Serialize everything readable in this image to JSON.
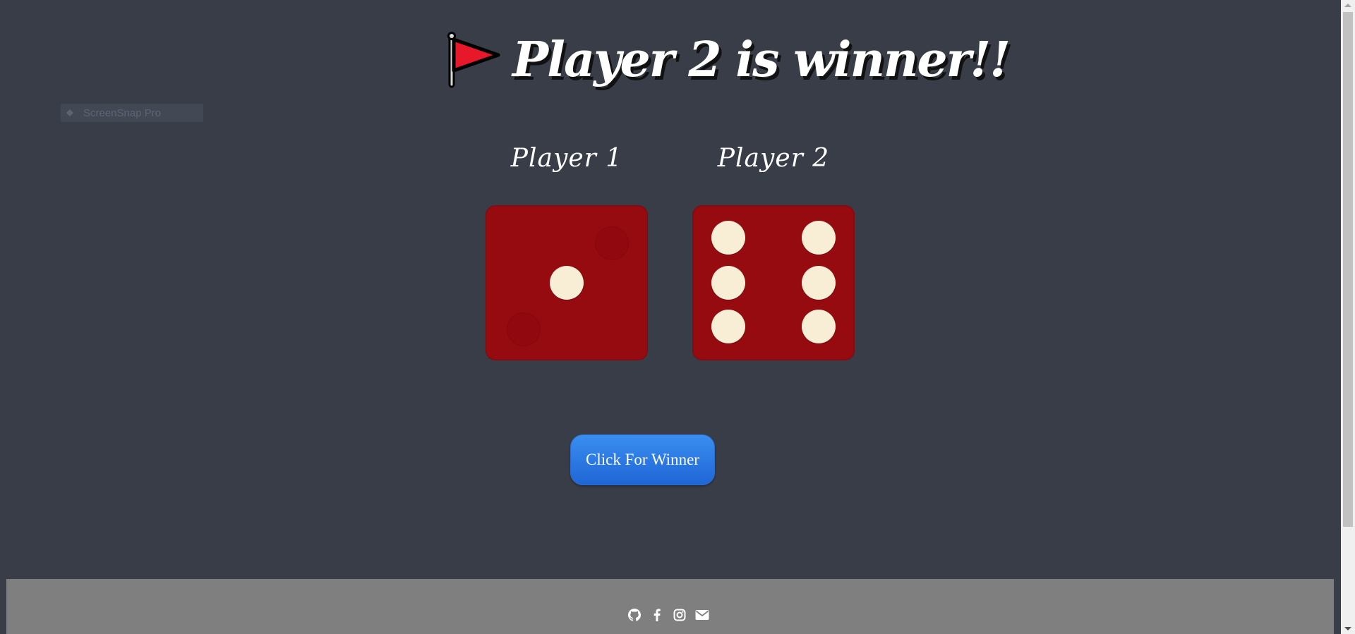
{
  "game": {
    "title": "Player 2 is winner!!",
    "flag_icon": "red-flag-icon",
    "ghost_widget_text": "ScreenSnap Pro"
  },
  "players": [
    {
      "label": "Player 1",
      "die_value": 1
    },
    {
      "label": "Player 2",
      "die_value": 6
    }
  ],
  "colors": {
    "background": "#393d47",
    "die": "#960b10",
    "pip": "#f8eed6",
    "button": "#2a78e4",
    "footer": "#7f7f7f"
  },
  "button": {
    "label": "Click For Winner"
  },
  "footer": {
    "icons": [
      "github-icon",
      "facebook-icon",
      "instagram-icon",
      "envelope-icon"
    ]
  }
}
